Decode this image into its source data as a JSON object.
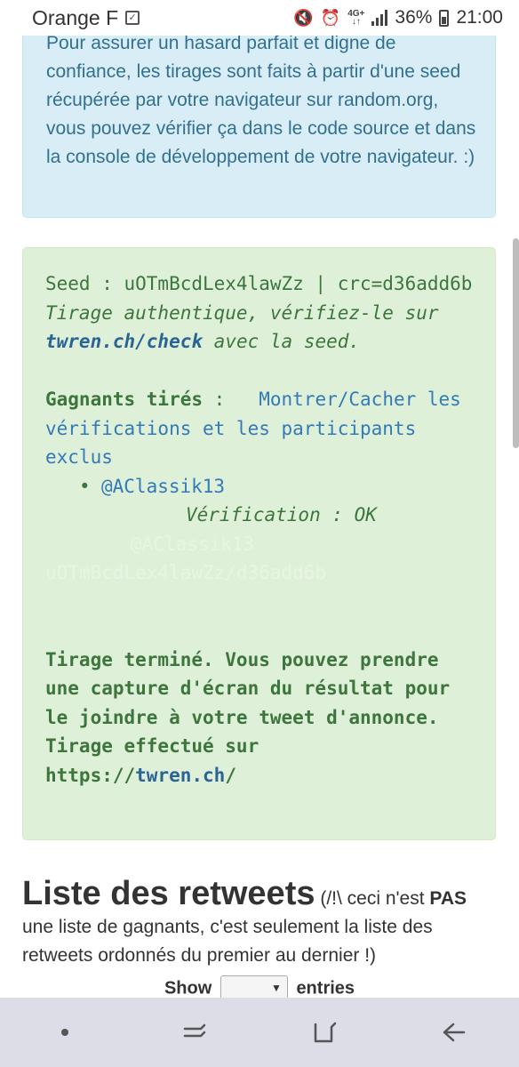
{
  "status_bar": {
    "carrier": "Orange F",
    "network": "4G+",
    "battery": "36%",
    "time": "21:00",
    "icons": [
      "notification-icon",
      "mute-icon",
      "alarm-icon",
      "network-icon",
      "signal-icon",
      "battery-icon"
    ]
  },
  "info_box": {
    "text": "Pour assurer un hasard parfait et digne de confiance, les tirages sont faits à partir d'une seed récupérée par votre navigateur sur random.org, vous pouvez vérifier ça dans le code source et dans la console de développement de votre navigateur. :)"
  },
  "result": {
    "seed_line": "Seed : uOTmBcdLex4lawZz | crc=d36add6b",
    "authentic_prefix": "Tirage authentique, vérifiez-le sur",
    "check_link": "twren.ch/check",
    "authentic_suffix": "avec la seed.",
    "winners_label": "Gagnants tirés",
    "winners_sep": " :",
    "toggle_link": "Montrer/Cacher les vérifications et les participants exclus",
    "winners": [
      "@AClassik13"
    ],
    "verification": "Vérification : OK",
    "faded_user": "@AClassik13",
    "faded_seed": "uOTmBcdLex4lawZz/d36add6b",
    "done_text": "Tirage terminé. Vous pouvez prendre une capture d'écran du résultat pour le joindre à votre tweet d'annonce.",
    "done_by": "Tirage effectué sur",
    "site_prefix": "https://",
    "site_link": "twren.ch",
    "site_suffix": "/"
  },
  "retweets": {
    "heading": "Liste des retweets",
    "note_prefix": "(/!\\ ceci n'est ",
    "note_bold": "PAS",
    "note_suffix": " une liste de gagnants, c'est seulement la liste des retweets ordonnés du premier au dernier !)",
    "show_label": "Show",
    "entries_label": "entries",
    "show_value": ""
  },
  "navbar": {
    "icons": [
      "dot-icon",
      "recent-apps-icon",
      "home-icon",
      "back-icon"
    ]
  },
  "colors": {
    "info_bg": "#d9edf7",
    "info_text": "#31708f",
    "success_bg": "#dff0d8",
    "success_text": "#3c763d",
    "link": "#337ab7",
    "navbar_bg": "#dddde7"
  }
}
